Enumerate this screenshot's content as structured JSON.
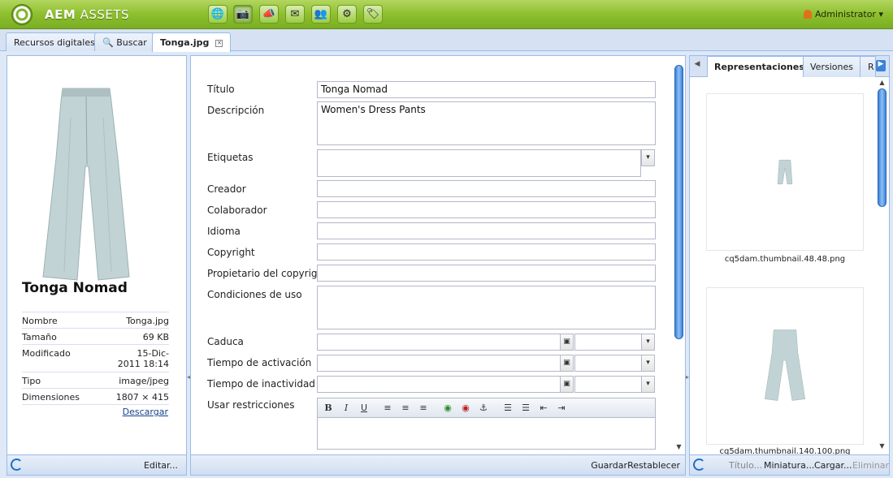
{
  "app": {
    "brand_bold": "AEM",
    "brand_rest": " ASSETS",
    "user": "Administrator",
    "toolbar_icons": [
      "globe-icon",
      "camera-icon",
      "megaphone-icon",
      "mail-icon",
      "users-icon",
      "gear-icon",
      "tag-icon"
    ]
  },
  "tabs": [
    {
      "label": "Recursos digitales"
    },
    {
      "label": "Buscar"
    },
    {
      "label": "Tonga.jpg"
    }
  ],
  "asset": {
    "title": "Tonga Nomad",
    "meta": [
      {
        "key": "Nombre",
        "value": "Tonga.jpg"
      },
      {
        "key": "Tamaño",
        "value": "69 KB"
      },
      {
        "key": "Modificado",
        "value": "15-Dic-2011 18:14"
      },
      {
        "key": "Tipo",
        "value": "image/jpeg"
      },
      {
        "key": "Dimensiones",
        "value": "1807 × 415"
      }
    ],
    "download": "Descargar",
    "edit": "Editar..."
  },
  "form": {
    "labels": {
      "titulo": "Título",
      "descripcion": "Descripción",
      "etiquetas": "Etiquetas",
      "creador": "Creador",
      "colaborador": "Colaborador",
      "idioma": "Idioma",
      "copyright": "Copyright",
      "propietario": "Propietario del copyright",
      "condiciones": "Condiciones de uso",
      "caduca": "Caduca",
      "activacion": "Tiempo de activación",
      "inactividad": "Tiempo de inactividad",
      "restricciones": "Usar restricciones"
    },
    "values": {
      "titulo": "Tonga Nomad",
      "descripcion": "Women's Dress Pants"
    },
    "save": "Guardar",
    "reset": "Restablecer"
  },
  "renditions": {
    "tabs": [
      "Representaciones",
      "Versiones",
      "R"
    ],
    "items": [
      {
        "caption": "cq5dam.thumbnail.48.48.png"
      },
      {
        "caption": "cq5dam.thumbnail.140.100.png"
      }
    ],
    "actions": [
      "Título...",
      "Miniatura...",
      "Cargar...",
      "Eliminar"
    ]
  },
  "colors": {
    "topbar": "#8dbf2e",
    "panel_border": "#99bbe8",
    "link": "#15428b"
  }
}
